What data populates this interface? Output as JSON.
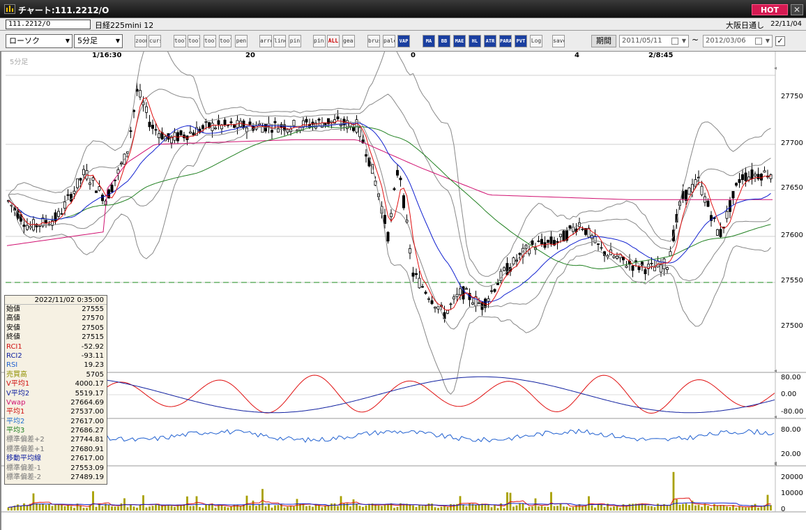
{
  "window": {
    "title": "チャート:111.2212/O",
    "hot_label": "HOT",
    "close_label": "✕"
  },
  "info": {
    "symbol": "111.2212/O",
    "instrument": "日経225mini 12",
    "session": "大阪日通し",
    "date": "22/11/04"
  },
  "toolbar": {
    "chart_type": "ローソク",
    "interval": "5分足",
    "buttons": [
      "zoom",
      "cursor",
      "tool-a",
      "tool-b",
      "tool-c",
      "tool-d",
      "pen",
      "arrow",
      "line",
      "pin",
      "pin-b",
      "ALL",
      "gear",
      "brush",
      "palette",
      "VAP",
      "MA",
      "BB",
      "MAE",
      "HL",
      "ATR",
      "PARA",
      "PVT",
      "Log",
      "save"
    ],
    "period_label": "期間",
    "date_from": "2011/05/11",
    "date_to": "2012/03/06",
    "tilde": "~",
    "checkbox_mark": "✓"
  },
  "chart": {
    "interval_label": "5分足",
    "price_axis": [
      "27750",
      "27700",
      "27650",
      "27600",
      "27550",
      "27500"
    ],
    "osc_axis": [
      "80.00",
      "0.00",
      "-80.00"
    ],
    "rsi_axis": [
      "80.00",
      "20.00"
    ],
    "vol_axis": [
      "20000",
      "10000",
      "0"
    ],
    "x_labels": [
      "1/16:30",
      "20",
      "0",
      "4",
      "2/8:45"
    ],
    "dashed_level": 27550,
    "colors": {
      "candle_up": "#ffffff",
      "candle_down": "#000000",
      "ma1": "#e01010",
      "ma2": "#1020d0",
      "ma3": "#208020",
      "vwap": "#d01070",
      "bands": "#888888",
      "rci1": "#e01010",
      "rci2": "#1020a0",
      "rsi": "#2060d0",
      "volume": "#a8a000",
      "dashed": "#1a8a1a"
    }
  },
  "datapanel": {
    "datetime": "2022/11/02 0:35:00",
    "rows": [
      {
        "label": "始値",
        "value": "27555",
        "color": "#000000"
      },
      {
        "label": "高値",
        "value": "27570",
        "color": "#000000"
      },
      {
        "label": "安値",
        "value": "27505",
        "color": "#000000"
      },
      {
        "label": "終値",
        "value": "27515",
        "color": "#000000"
      },
      {
        "label": "RCI1",
        "value": "-52.92",
        "color": "#d01010"
      },
      {
        "label": "RCI2",
        "value": "-93.11",
        "color": "#1020a0"
      },
      {
        "label": "RSI",
        "value": "19.23",
        "color": "#2060d0"
      },
      {
        "label": "売買高",
        "value": "5705",
        "color": "#909000"
      },
      {
        "label": "V平均1",
        "value": "4000.17",
        "color": "#d01010"
      },
      {
        "label": "V平均2",
        "value": "5519.17",
        "color": "#1020a0"
      },
      {
        "label": "Vwap",
        "value": "27664.69",
        "color": "#d01070"
      },
      {
        "label": "平均1",
        "value": "27537.00",
        "color": "#d01010"
      },
      {
        "label": "平均2",
        "value": "27617.00",
        "color": "#2070d0"
      },
      {
        "label": "平均3",
        "value": "27686.27",
        "color": "#208020"
      },
      {
        "label": "標準偏差+2",
        "value": "27744.81",
        "color": "#777777"
      },
      {
        "label": "標準偏差+1",
        "value": "27680.91",
        "color": "#777777"
      },
      {
        "label": "移動平均線",
        "value": "27617.00",
        "color": "#1020a0"
      },
      {
        "label": "標準偏差-1",
        "value": "27553.09",
        "color": "#777777"
      },
      {
        "label": "標準偏差-2",
        "value": "27489.19",
        "color": "#777777"
      }
    ]
  }
}
